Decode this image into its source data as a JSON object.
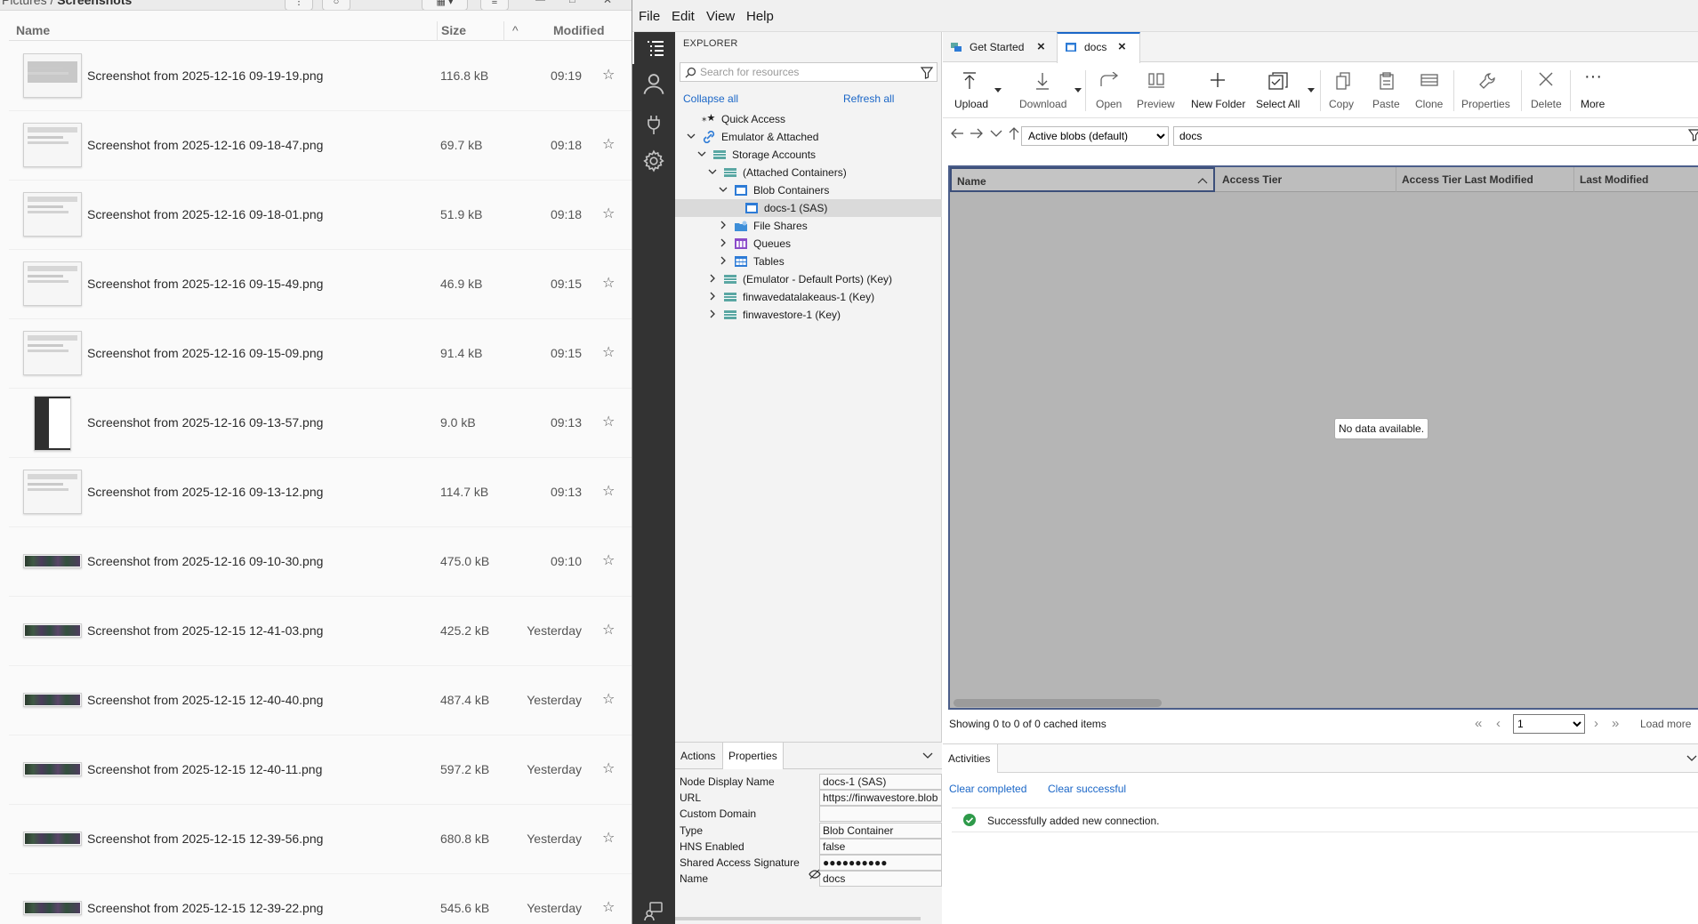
{
  "file_manager": {
    "path_parent": "Pictures",
    "path_sep": "/",
    "path_current": "Screenshots",
    "columns": {
      "name": "Name",
      "size": "Size",
      "modified": "Modified"
    },
    "files": [
      {
        "name": "Screenshot from 2025-12-16 09-19-19.png",
        "size": "116.8 kB",
        "modified": "09:19"
      },
      {
        "name": "Screenshot from 2025-12-16 09-18-47.png",
        "size": "69.7 kB",
        "modified": "09:18"
      },
      {
        "name": "Screenshot from 2025-12-16 09-18-01.png",
        "size": "51.9 kB",
        "modified": "09:18"
      },
      {
        "name": "Screenshot from 2025-12-16 09-15-49.png",
        "size": "46.9 kB",
        "modified": "09:15"
      },
      {
        "name": "Screenshot from 2025-12-16 09-15-09.png",
        "size": "91.4 kB",
        "modified": "09:15"
      },
      {
        "name": "Screenshot from 2025-12-16 09-13-57.png",
        "size": "9.0 kB",
        "modified": "09:13"
      },
      {
        "name": "Screenshot from 2025-12-16 09-13-12.png",
        "size": "114.7 kB",
        "modified": "09:13"
      },
      {
        "name": "Screenshot from 2025-12-16 09-10-30.png",
        "size": "475.0 kB",
        "modified": "09:10"
      },
      {
        "name": "Screenshot from 2025-12-15 12-41-03.png",
        "size": "425.2 kB",
        "modified": "Yesterday"
      },
      {
        "name": "Screenshot from 2025-12-15 12-40-40.png",
        "size": "487.4 kB",
        "modified": "Yesterday"
      },
      {
        "name": "Screenshot from 2025-12-15 12-40-11.png",
        "size": "597.2 kB",
        "modified": "Yesterday"
      },
      {
        "name": "Screenshot from 2025-12-15 12-39-56.png",
        "size": "680.8 kB",
        "modified": "Yesterday"
      },
      {
        "name": "Screenshot from 2025-12-15 12-39-22.png",
        "size": "545.6 kB",
        "modified": "Yesterday"
      }
    ]
  },
  "storage_explorer": {
    "menu": {
      "file": "File",
      "edit": "Edit",
      "view": "View",
      "help": "Help"
    },
    "explorer": {
      "title": "EXPLORER",
      "search_placeholder": "Search for resources",
      "collapse_all": "Collapse all",
      "refresh_all": "Refresh all",
      "tree": {
        "quick_access": "Quick Access",
        "emulator_attached": "Emulator & Attached",
        "storage_accounts": "Storage Accounts",
        "attached_containers": "(Attached Containers)",
        "blob_containers": "Blob Containers",
        "docs1": "docs-1 (SAS)",
        "file_shares": "File Shares",
        "queues": "Queues",
        "tables": "Tables",
        "emulator_default": "(Emulator - Default Ports) (Key)",
        "finwavedatalake": "finwavedatalakeaus-1 (Key)",
        "finwavestore": "finwavestore-1 (Key)"
      }
    },
    "properties": {
      "tab_actions": "Actions",
      "tab_properties": "Properties",
      "rows": [
        {
          "key": "Node Display Name",
          "value": "docs-1 (SAS)"
        },
        {
          "key": "URL",
          "value": "https://finwavestore.blob"
        },
        {
          "key": "Custom Domain",
          "value": ""
        },
        {
          "key": "Type",
          "value": "Blob Container"
        },
        {
          "key": "HNS Enabled",
          "value": "false"
        },
        {
          "key": "Shared Access Signature",
          "value": "●●●●●●●●●●"
        },
        {
          "key": "Name",
          "value": "docs"
        }
      ]
    },
    "tabs": {
      "get_started": "Get Started",
      "docs": "docs"
    },
    "toolbar": {
      "upload": "Upload",
      "download": "Download",
      "open": "Open",
      "preview": "Preview",
      "new_folder": "New Folder",
      "select_all": "Select All",
      "copy": "Copy",
      "paste": "Paste",
      "clone": "Clone",
      "properties": "Properties",
      "delete": "Delete",
      "more": "More"
    },
    "address": {
      "blob_filter": "Active blobs (default)",
      "path": "docs"
    },
    "grid": {
      "columns": [
        "Name",
        "Access Tier",
        "Access Tier Last Modified",
        "Last Modified"
      ],
      "empty": "No data available."
    },
    "status": {
      "showing": "Showing 0 to 0 of 0 cached items",
      "page": "1",
      "load_more": "Load more"
    },
    "activities": {
      "title": "Activities",
      "clear_completed": "Clear completed",
      "clear_successful": "Clear successful",
      "item": "Successfully added new connection."
    }
  }
}
